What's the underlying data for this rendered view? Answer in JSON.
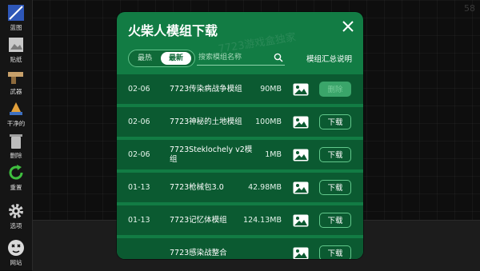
{
  "fps": "58",
  "toolbar": [
    {
      "label": "蓝图",
      "icon": "blueprint-icon"
    },
    {
      "label": "贴纸",
      "icon": "sticker-icon"
    },
    {
      "label": "武器",
      "icon": "pistol-icon"
    },
    {
      "label": "干净的",
      "icon": "clean-icon"
    },
    {
      "label": "删除",
      "icon": "trash-icon"
    },
    {
      "label": "重置",
      "icon": "reset-icon"
    },
    {
      "label": "选项",
      "icon": "gear-icon"
    },
    {
      "label": "网站",
      "icon": "skull-face-icon"
    }
  ],
  "dialog": {
    "title": "火柴人模组下载",
    "watermark": "7723游戏盒独家",
    "tabs": {
      "hot": "最热",
      "new": "最新",
      "active": "new"
    },
    "search": {
      "placeholder": "搜索模组名称",
      "value": ""
    },
    "summary_link": "模组汇总说明",
    "colors": {
      "dialog_bg": "#127c44",
      "row_bg": "#0b5a31",
      "button_border": "#62c98c"
    },
    "rows": [
      {
        "date": "02-06",
        "name": "7723传染病战争模组",
        "size": "90MB",
        "button": "删除",
        "disabled": true
      },
      {
        "date": "02-06",
        "name": "7723神秘的土地模组",
        "size": "100MB",
        "button": "下载",
        "disabled": false
      },
      {
        "date": "02-06",
        "name": "7723Steklochely v2模组",
        "size": "1MB",
        "button": "下载",
        "disabled": false
      },
      {
        "date": "01-13",
        "name": "7723枪械包3.0",
        "size": "42.98MB",
        "button": "下载",
        "disabled": false
      },
      {
        "date": "01-13",
        "name": "7723记忆体模组",
        "size": "124.13MB",
        "button": "下载",
        "disabled": false
      },
      {
        "date": "",
        "name": "7723感染战整合",
        "size": "",
        "button": "下载",
        "disabled": false
      }
    ]
  }
}
